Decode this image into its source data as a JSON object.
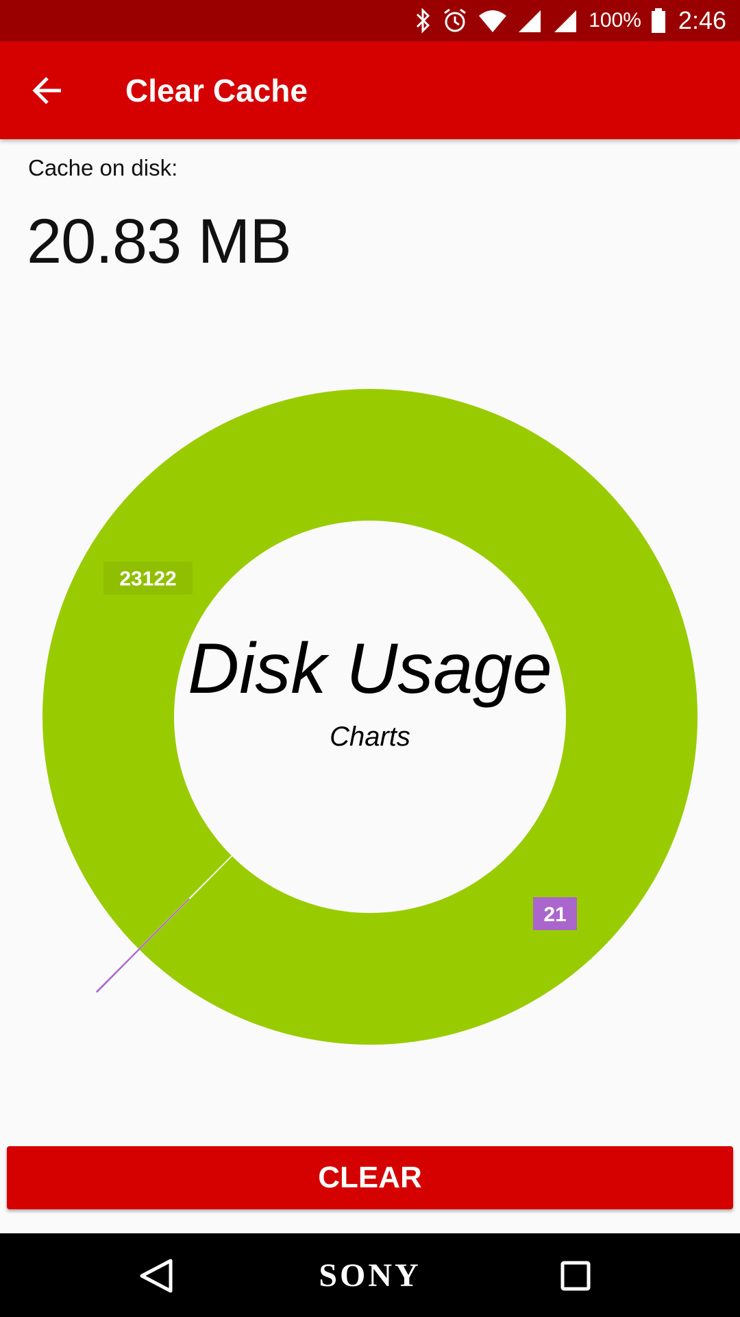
{
  "status_bar": {
    "battery_percent": "100%",
    "time": "2:46",
    "icons": [
      "bluetooth-icon",
      "alarm-icon",
      "wifi-icon",
      "signal-icon",
      "signal-icon",
      "battery-icon"
    ]
  },
  "app_bar": {
    "title": "Clear Cache",
    "back_icon": "arrow-left-icon"
  },
  "cache": {
    "label": "Cache on disk:",
    "value": "20.83 MB"
  },
  "chart_data": {
    "type": "pie",
    "title": "Disk Usage",
    "subtitle": "Charts",
    "slices": [
      {
        "label": "23122",
        "value": 23122,
        "color": "#99cc00"
      },
      {
        "label": "21",
        "value": 21,
        "color": "#aa66cc"
      }
    ]
  },
  "clear_button": {
    "label": "CLEAR"
  },
  "nav_bar": {
    "home_label": "SONY",
    "icons": [
      "nav-back-icon",
      "nav-recents-icon"
    ]
  },
  "colors": {
    "primary": "#d50000",
    "primary_dark": "#9b0000",
    "background": "#fafafa",
    "chart_green": "#99cc00",
    "chart_purple": "#aa66cc"
  }
}
